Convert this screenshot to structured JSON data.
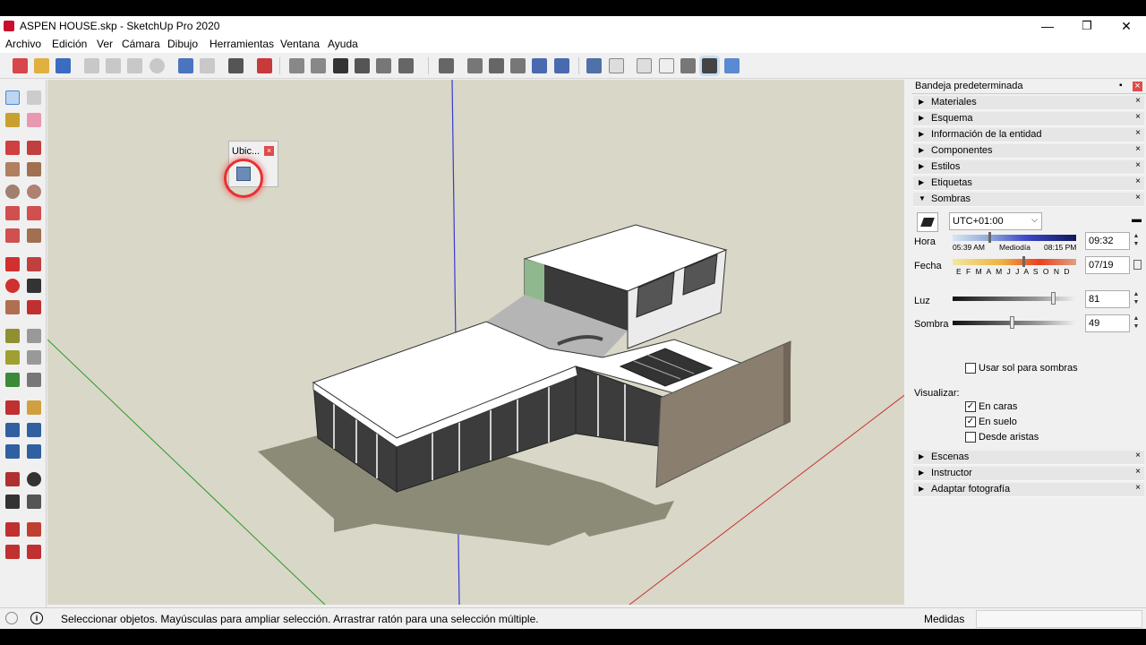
{
  "window": {
    "title": "ASPEN HOUSE.skp - SketchUp Pro 2020",
    "minimize": "—",
    "maximize": "❐",
    "close": "✕"
  },
  "menu": [
    "Archivo",
    "Edición",
    "Ver",
    "Cámara",
    "Dibujo",
    "Herramientas",
    "Ventana",
    "Ayuda"
  ],
  "floating_toolbar": {
    "title": "Ubic...",
    "close": "×",
    "icon": "add-location-icon"
  },
  "tray": {
    "title": "Bandeja predeterminada",
    "panels_top": [
      "Materiales",
      "Esquema",
      "Información de la entidad",
      "Componentes",
      "Estilos",
      "Etiquetas"
    ],
    "shadows_panel": "Sombras",
    "panels_bottom": [
      "Escenas",
      "Instructor",
      "Adaptar fotografía"
    ],
    "shadows": {
      "timezone": "UTC+01:00",
      "hora_label": "Hora",
      "hora_start": "05:39 AM",
      "hora_mid": "Mediodía",
      "hora_end": "08:15 PM",
      "hora_value": "09:32",
      "fecha_label": "Fecha",
      "months": "E F M A M J J A S O N D",
      "fecha_value": "07/19",
      "luz_label": "Luz",
      "luz_value": "81",
      "sombra_label": "Sombra",
      "sombra_value": "49",
      "use_sun_label": "Usar sol para sombras",
      "use_sun_checked": false,
      "visualizar_label": "Visualizar:",
      "en_caras_label": "En caras",
      "en_caras_checked": true,
      "en_suelo_label": "En suelo",
      "en_suelo_checked": true,
      "desde_aristas_label": "Desde aristas",
      "desde_aristas_checked": false
    }
  },
  "status": {
    "message": "Seleccionar objetos. Mayúsculas para ampliar selección. Arrastrar ratón para una selección múltiple.",
    "measurements_label": "Medidas",
    "measurements_value": ""
  },
  "colors": {
    "viewport_bg": "#d9d7c7",
    "accent_red": "#c8102e",
    "axis_blue": "#3a3ad0",
    "axis_green": "#2a9a2a",
    "axis_red": "#c83232"
  }
}
